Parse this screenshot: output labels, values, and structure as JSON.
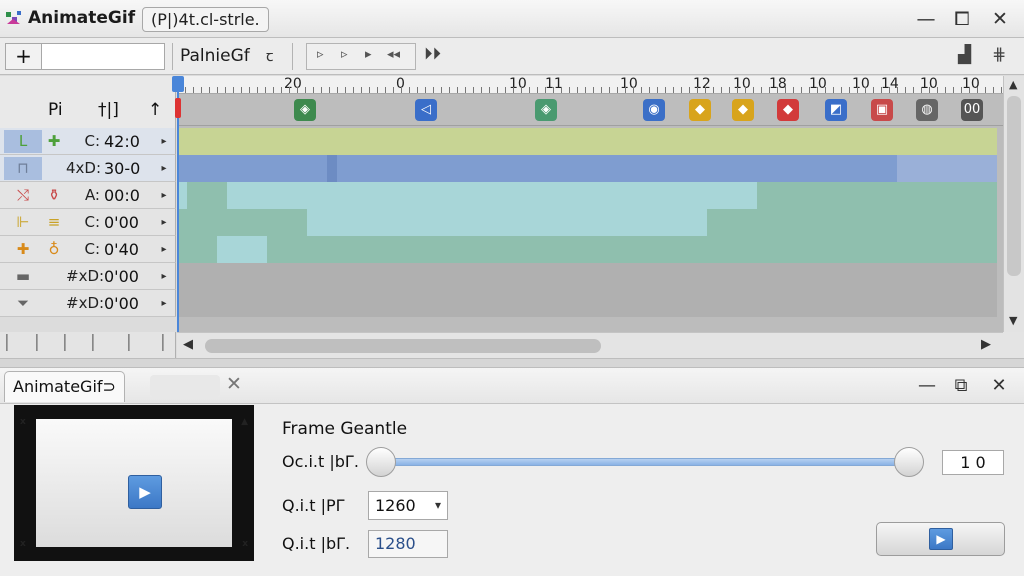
{
  "window": {
    "app_name": "AnimateGif",
    "project_label": "(P|)4t.cl-strle.",
    "minimize_icon": "—",
    "maximize_icon": "⧠",
    "close_icon": "✕"
  },
  "toolbar": {
    "add_icon": "+",
    "input_value": "",
    "palette_label": "PalnieGf",
    "palette_icon": "ꞇ",
    "transport": [
      "▹",
      "▹",
      "▸",
      "◂◂"
    ],
    "play_next_icon": "⏵⏵",
    "chart_icon": "▟",
    "grid_icon": "⋕"
  },
  "layers": {
    "headers": [
      "Pi",
      "†|]",
      "↑"
    ],
    "rows": [
      {
        "c1": "L",
        "c2": "✚",
        "c3": "C:",
        "c4": "42:0",
        "icon_color": "#4da03a",
        "selected": true
      },
      {
        "c1": "⊓",
        "c2": "",
        "c3": "4xD:",
        "c4": "30-0",
        "icon_color": "#6f7f9a",
        "selected": true
      },
      {
        "c1": "⤭",
        "c2": "⚱",
        "c3": "A:",
        "c4": "00:0",
        "icon_color": "#c84a4a",
        "selected": false
      },
      {
        "c1": "⊩",
        "c2": "≡",
        "c3": "C:",
        "c4": "0'00",
        "icon_color": "#c9a227",
        "selected": false
      },
      {
        "c1": "✚",
        "c2": "♁",
        "c3": "C:",
        "c4": "0'40",
        "icon_color": "#d88a1a",
        "selected": false
      },
      {
        "c1": "▬",
        "c2": "",
        "c3": "#xD:",
        "c4": "0'00",
        "icon_color": "#666",
        "selected": false
      },
      {
        "c1": "⏷",
        "c2": "",
        "c3": "#xD:",
        "c4": "0'00",
        "icon_color": "#666",
        "selected": false
      }
    ],
    "expand_icon": "▸"
  },
  "ruler": {
    "labels": [
      "20",
      "0",
      "10",
      "11",
      "10",
      "12",
      "10",
      "18",
      "10",
      "10",
      "14",
      "10",
      "10"
    ]
  },
  "keyframes": [
    {
      "icon": "◈",
      "color": "#3e8a4e"
    },
    {
      "icon": "◁",
      "color": "#3a6ec9"
    },
    {
      "icon": "◈",
      "color": "#4a9a70"
    },
    {
      "icon": "◉",
      "color": "#3b6fc7"
    },
    {
      "icon": "◆",
      "color": "#d8a41c"
    },
    {
      "icon": "◆",
      "color": "#d8a41c"
    },
    {
      "icon": "◆",
      "color": "#d23a3a"
    },
    {
      "icon": "◩",
      "color": "#3a6ec9"
    },
    {
      "icon": "▣",
      "color": "#c84a4a"
    },
    {
      "icon": "◍",
      "color": "#666666"
    },
    {
      "icon": "00",
      "color": "#555555"
    }
  ],
  "colors": {
    "accent": "#4a86d9",
    "track_olive": "#c7d494",
    "track_blue": "#7f9dd0",
    "track_teal": "#8fbfae",
    "track_cyan": "#a8d6d8",
    "track_gray": "#b0b0b0"
  },
  "panel": {
    "tab_label": "AnimateGif⊃",
    "tab_close_icon": "✕",
    "minimize_icon": "—",
    "maximize_icon": "⧉",
    "close_icon": "✕",
    "preview_play_icon": "▶",
    "preview_corners": [
      "x",
      "▲",
      "x",
      "x"
    ],
    "frame_label": "Frame Geantle",
    "row1_label": "Oc.i.t |bΓ.",
    "row2_label": "Q.i.t |PΓ",
    "row3_label": "Q.i.t |bΓ.",
    "slider_value": "1 0",
    "select_value": "1260",
    "field_value": "1280",
    "play_icon": "▶",
    "chevron_icon": "▾"
  }
}
